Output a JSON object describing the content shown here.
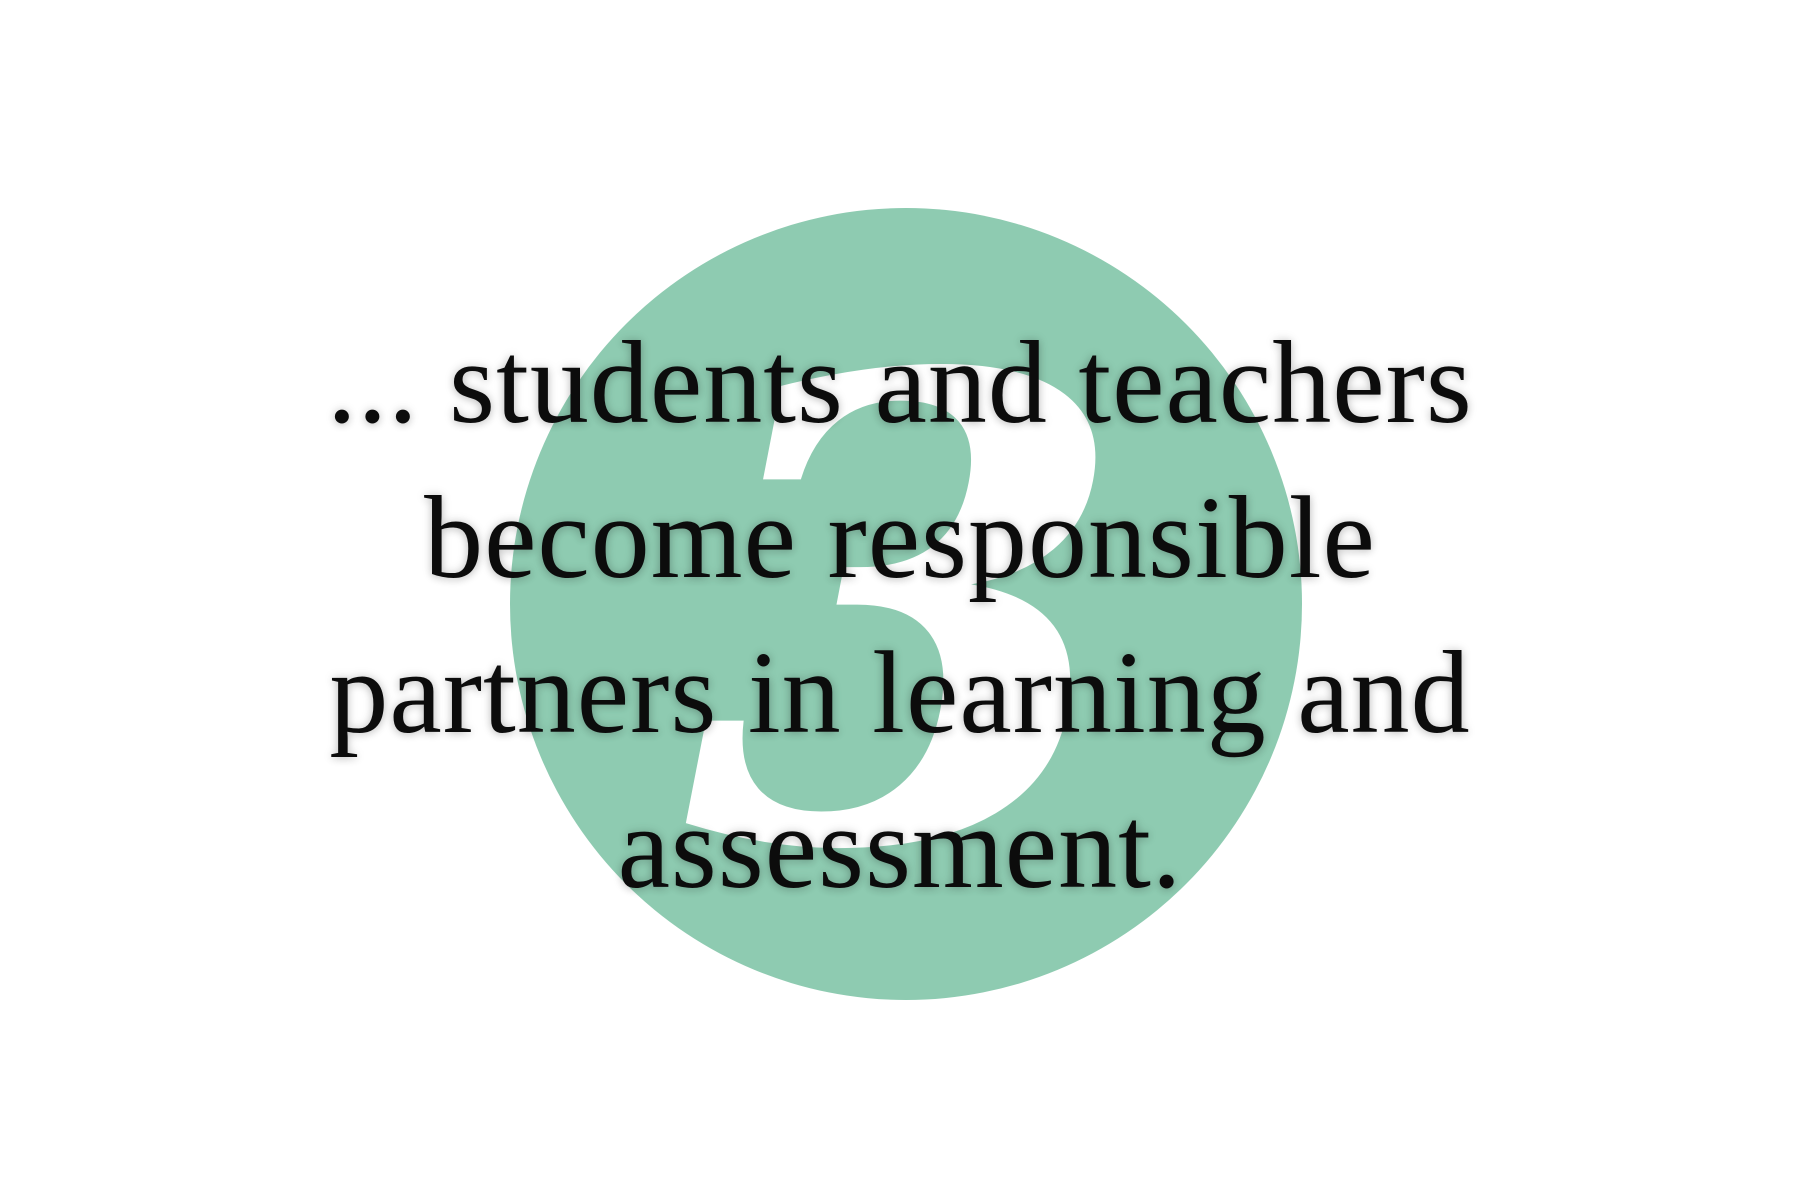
{
  "graphic": {
    "circle_color": "#8ecbb1",
    "numeral": "3",
    "numeral_color": "#ffffff"
  },
  "quote": {
    "lines": [
      "... students and teachers",
      "become responsible",
      "partners in learning and",
      "assessment."
    ],
    "text_color": "#0c0c0c"
  }
}
